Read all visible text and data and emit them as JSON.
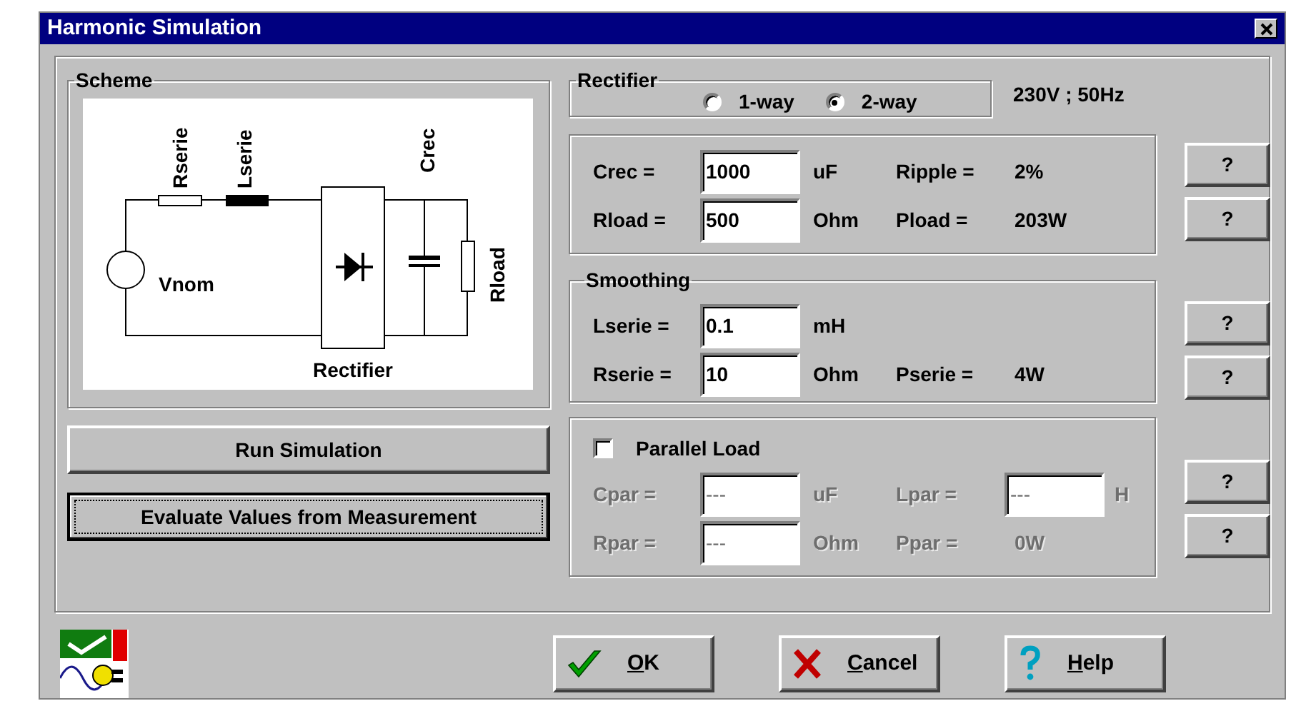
{
  "window": {
    "title": "Harmonic Simulation"
  },
  "scheme": {
    "title": "Scheme",
    "labels": {
      "rserie": "Rserie",
      "lserie": "Lserie",
      "crec": "Crec",
      "rload": "Rload",
      "vnom": "Vnom",
      "rectifier": "Rectifier"
    }
  },
  "actions": [
    {
      "label": "Run Simulation",
      "focused": false
    },
    {
      "label": "Evaluate Values from Measurement",
      "focused": true
    }
  ],
  "rectifier": {
    "title": "Rectifier",
    "options": [
      {
        "label": "1-way",
        "selected": false
      },
      {
        "label": "2-way",
        "selected": true
      }
    ],
    "supply": "230V ; 50Hz"
  },
  "groups": [
    {
      "rows": [
        {
          "label": "Crec =",
          "value": "1000",
          "unit": "uF",
          "label2": "Ripple =",
          "result": "2%",
          "disabled": false,
          "help": "?"
        },
        {
          "label": "Rload =",
          "value": "500",
          "unit": "Ohm",
          "label2": "Pload =",
          "result": "203W",
          "disabled": false,
          "help": "?"
        }
      ]
    },
    {
      "title": "Smoothing",
      "rows": [
        {
          "label": "Lserie =",
          "value": "0.1",
          "unit": "mH",
          "disabled": false,
          "help": "?"
        },
        {
          "label": "Rserie =",
          "value": "10",
          "unit": "Ohm",
          "label2": "Pserie =",
          "result": "4W",
          "disabled": false,
          "help": "?"
        }
      ]
    }
  ],
  "parallel": {
    "checkbox": {
      "label": "Parallel Load",
      "checked": false
    },
    "rows": [
      {
        "label": "Cpar =",
        "value": "---",
        "unit": "uF",
        "label2": "Lpar =",
        "input2": "---",
        "unit2": "H",
        "disabled": true,
        "help": "?"
      },
      {
        "label": "Rpar =",
        "value": "---",
        "unit": "Ohm",
        "label2": "Ppar =",
        "result": "0W",
        "disabled": true,
        "help": "?"
      }
    ]
  },
  "footer": [
    {
      "label": "OK",
      "kind": "ok"
    },
    {
      "label": "Cancel",
      "kind": "cancel"
    },
    {
      "label": "Help",
      "kind": "help"
    }
  ]
}
